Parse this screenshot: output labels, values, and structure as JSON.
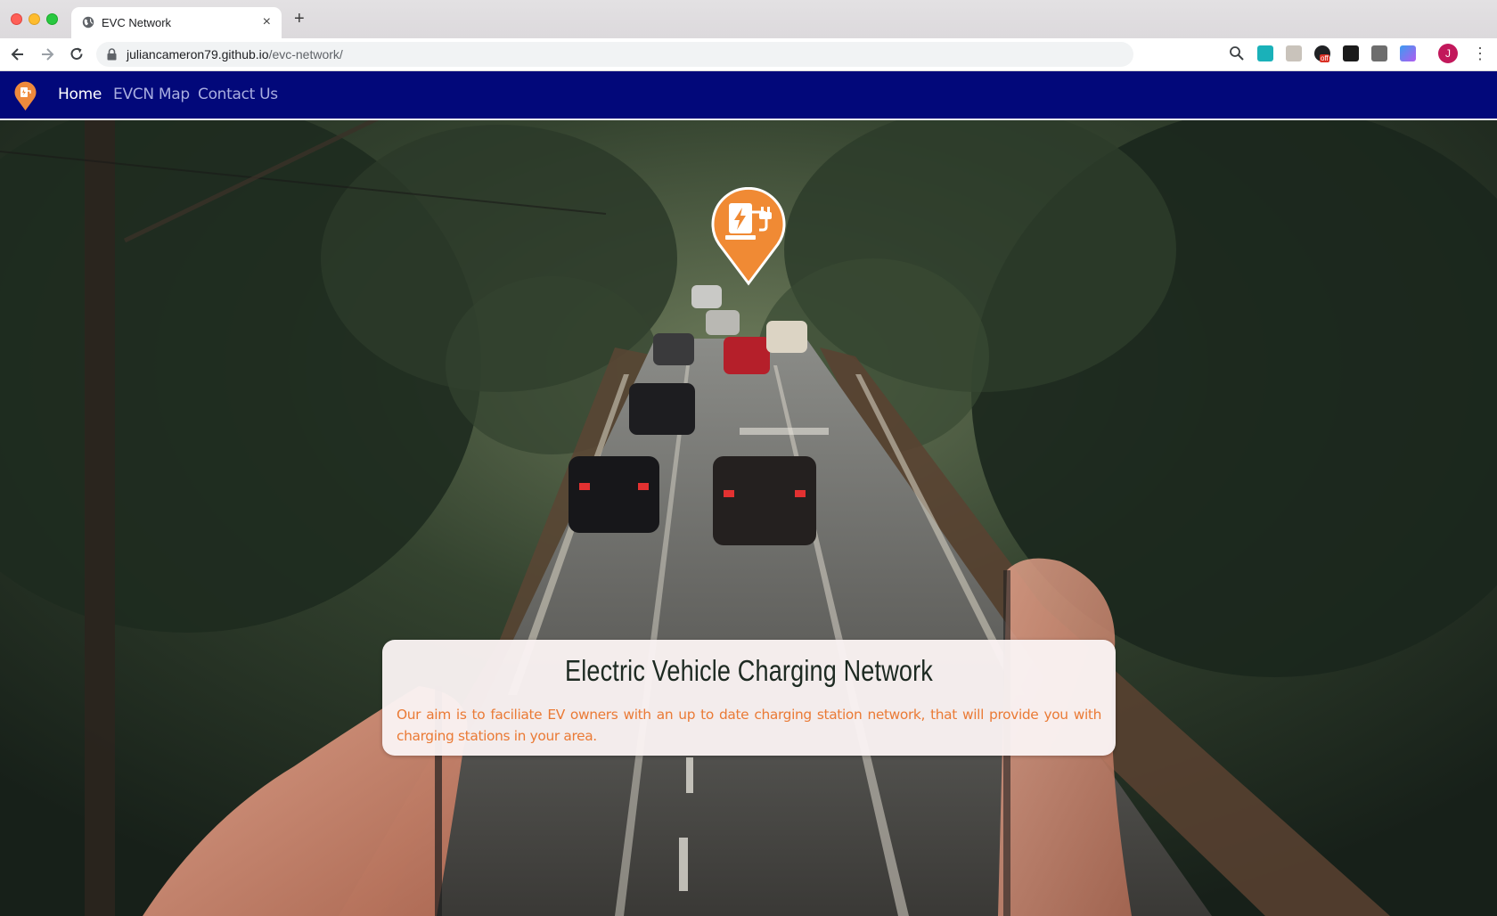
{
  "browser": {
    "tab_title": "EVC Network",
    "tab_close": "×",
    "new_tab": "+",
    "url_host": "juliancameron79.github.io",
    "url_path": "/evc-network/",
    "profile_initial": "J",
    "menu": "⋮",
    "extension_badge": "off"
  },
  "site": {
    "nav": {
      "items": [
        {
          "label": "Home",
          "active": true
        },
        {
          "label": "EVCN Map",
          "active": false
        },
        {
          "label": "Contact Us",
          "active": false
        }
      ]
    },
    "hero": {
      "title": "Electric Vehicle Charging Network",
      "description": "Our aim is to faciliate EV owners with an up to date charging station network, that will provide you with charging stations in your area."
    },
    "colors": {
      "nav_background": "#02087a",
      "accent_orange": "#ea7a35",
      "card_background": "#faf2f3",
      "title_color": "#1d2a22"
    }
  }
}
